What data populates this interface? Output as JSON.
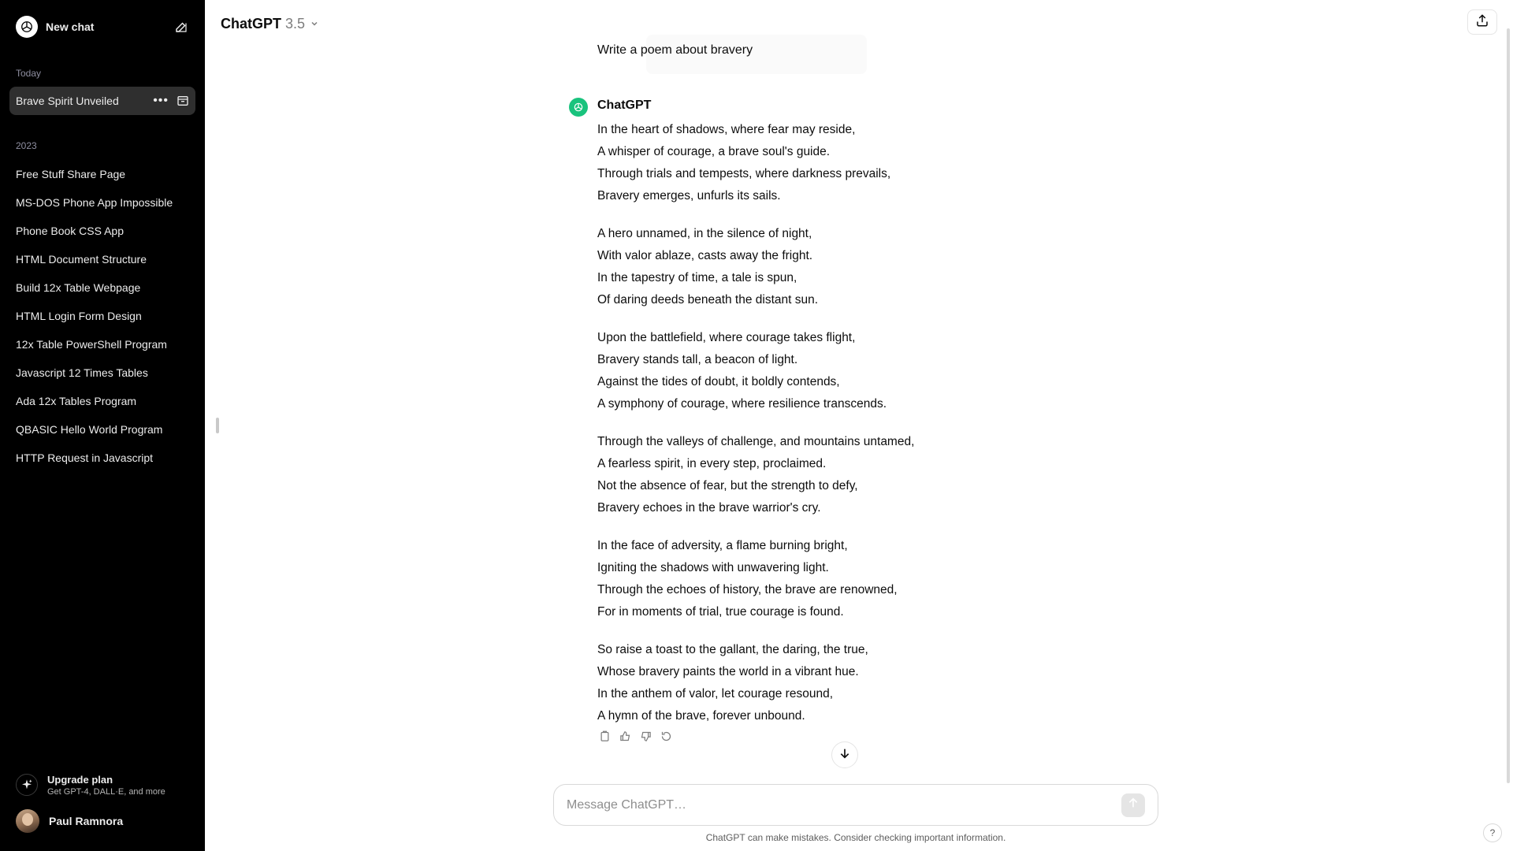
{
  "sidebar": {
    "new_chat_label": "New chat",
    "sections": [
      {
        "label": "Today"
      },
      {
        "label": "2023"
      }
    ],
    "active_item": "Brave Spirit Unveiled",
    "items_2023": [
      "Free Stuff Share Page",
      "MS-DOS Phone App Impossible",
      "Phone Book CSS App",
      "HTML Document Structure",
      "Build 12x Table Webpage",
      "HTML Login Form Design",
      "12x Table PowerShell Program",
      "Javascript 12 Times Tables",
      "Ada 12x Tables Program",
      "QBASIC Hello World Program",
      "HTTP Request in Javascript"
    ],
    "upgrade": {
      "title": "Upgrade plan",
      "subtitle": "Get GPT-4, DALL·E, and more"
    },
    "user_name": "Paul Ramnora"
  },
  "header": {
    "model_name": "ChatGPT",
    "model_version": "3.5"
  },
  "conversation": {
    "user_message": "Write a poem about bravery",
    "assistant_name": "ChatGPT",
    "poem": [
      [
        "In the heart of shadows, where fear may reside,",
        "A whisper of courage, a brave soul's guide.",
        "Through trials and tempests, where darkness prevails,",
        "Bravery emerges, unfurls its sails."
      ],
      [
        "A hero unnamed, in the silence of night,",
        "With valor ablaze, casts away the fright.",
        "In the tapestry of time, a tale is spun,",
        "Of daring deeds beneath the distant sun."
      ],
      [
        "Upon the battlefield, where courage takes flight,",
        "Bravery stands tall, a beacon of light.",
        "Against the tides of doubt, it boldly contends,",
        "A symphony of courage, where resilience transcends."
      ],
      [
        "Through the valleys of challenge, and mountains untamed,",
        "A fearless spirit, in every step, proclaimed.",
        "Not the absence of fear, but the strength to defy,",
        "Bravery echoes in the brave warrior's cry."
      ],
      [
        "In the face of adversity, a flame burning bright,",
        "Igniting the shadows with unwavering light.",
        "Through the echoes of history, the brave are renowned,",
        "For in moments of trial, true courage is found."
      ],
      [
        "So raise a toast to the gallant, the daring, the true,",
        "Whose bravery paints the world in a vibrant hue.",
        "In the anthem of valor, let courage resound,",
        "A hymn of the brave, forever unbound."
      ]
    ]
  },
  "composer": {
    "placeholder": "Message ChatGPT…",
    "value": ""
  },
  "footer": {
    "disclaimer": "ChatGPT can make mistakes. Consider checking important information.",
    "help_label": "?"
  },
  "icons": {
    "logo": "openai-logo-icon",
    "new_chat": "edit-icon",
    "item_menu": "dots-icon",
    "archive": "archive-icon",
    "upgrade": "sparkle-icon",
    "share": "share-icon",
    "copy": "clipboard-icon",
    "like": "thumbs-up-icon",
    "dislike": "thumbs-down-icon",
    "regenerate": "regenerate-icon",
    "scroll_down": "arrow-down-icon",
    "send": "arrow-up-icon"
  },
  "colors": {
    "sidebar_bg": "#000000",
    "active_item_bg": "#2f2f2f",
    "assistant_avatar": "#19c37d"
  }
}
